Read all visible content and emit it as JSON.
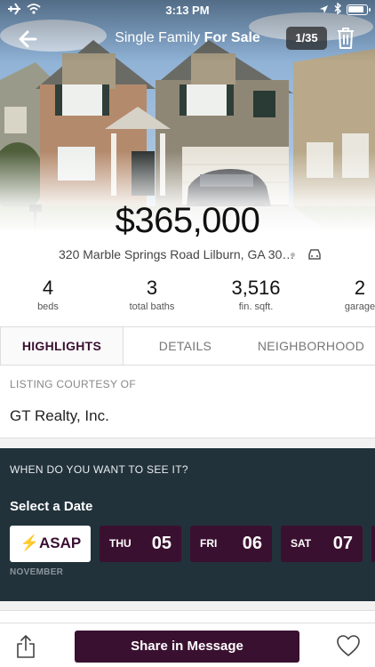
{
  "status_bar": {
    "time": "3:13 PM",
    "icons": [
      "airplane-icon",
      "wifi-icon",
      "location-arrow-icon",
      "bluetooth-icon",
      "battery-icon"
    ]
  },
  "nav": {
    "title_prefix": "Single Family",
    "title_suffix": "For Sale",
    "photo_counter": "1/35",
    "icons": [
      "back-arrow-icon",
      "trash-icon"
    ]
  },
  "listing": {
    "price": "$365,000",
    "address": "320 Marble Springs Road Lilburn, GA 30…"
  },
  "stats": [
    {
      "value": "4",
      "label": "beds"
    },
    {
      "value": "3",
      "label": "total baths"
    },
    {
      "value": "3,516",
      "label": "fin. sqft."
    },
    {
      "value": "2",
      "label": "garage"
    }
  ],
  "tabs": [
    {
      "label": "HIGHLIGHTS",
      "active": true
    },
    {
      "label": "DETAILS",
      "active": false
    },
    {
      "label": "NEIGHBORHOOD",
      "active": false
    }
  ],
  "courtesy": {
    "label": "LISTING COURTESY OF",
    "name": "GT Realty, Inc."
  },
  "schedule": {
    "question": "WHEN DO YOU WANT TO SEE IT?",
    "select_label": "Select a Date",
    "asap_label": "ASAP",
    "month": "NOVEMBER",
    "dates": [
      {
        "day": "THU",
        "num": "05"
      },
      {
        "day": "FRI",
        "num": "06"
      },
      {
        "day": "SAT",
        "num": "07"
      }
    ]
  },
  "bottom_bar": {
    "share_message_label": "Share in Message",
    "icons": [
      "share-icon",
      "heart-icon"
    ]
  },
  "colors": {
    "brand": "#3a1030",
    "panel_bg": "#22323b",
    "asap_bolt": "#e0a400"
  }
}
